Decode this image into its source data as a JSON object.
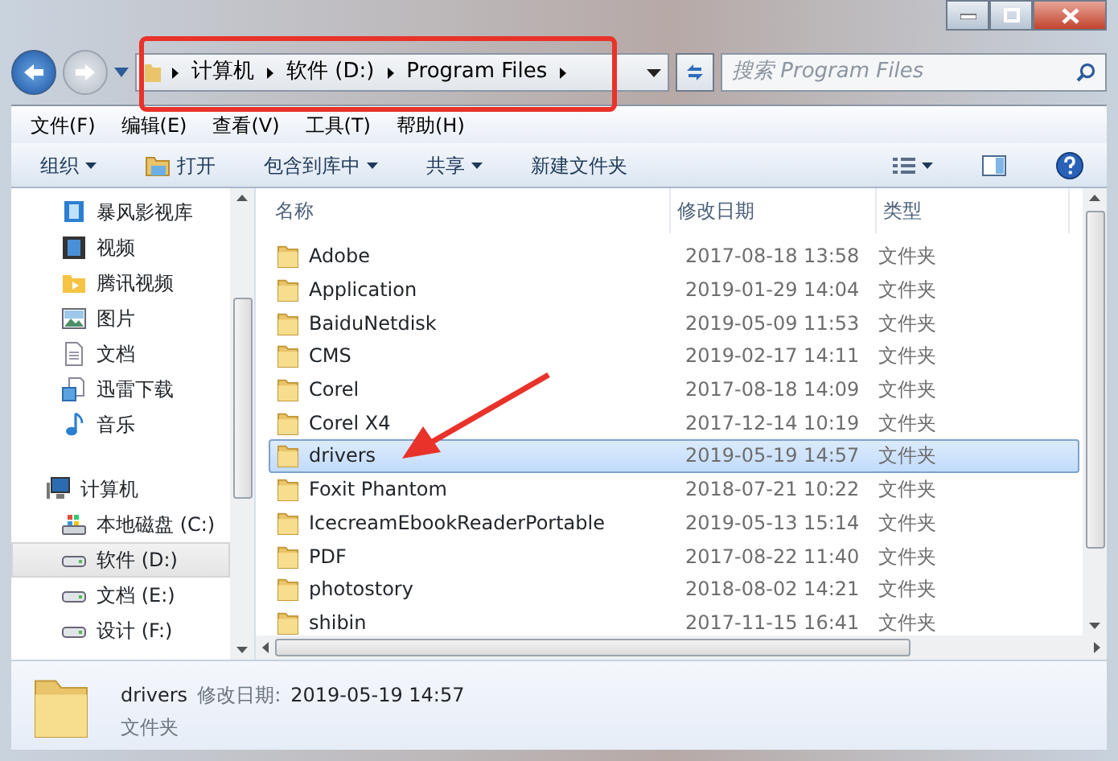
{
  "address": {
    "crumbs": [
      "计算机",
      "软件 (D:)",
      "Program Files"
    ]
  },
  "search": {
    "placeholder": "搜索 Program Files"
  },
  "menu": [
    "文件(F)",
    "编辑(E)",
    "查看(V)",
    "工具(T)",
    "帮助(H)"
  ],
  "toolbar": [
    {
      "label": "组织",
      "kind": "menu"
    },
    {
      "label": "打开",
      "kind": "open"
    },
    {
      "label": "包含到库中",
      "kind": "menu"
    },
    {
      "label": "共享",
      "kind": "menu"
    },
    {
      "label": "新建文件夹",
      "kind": "plain"
    }
  ],
  "sidebar": {
    "libraries": [
      {
        "label": "暴风影视库",
        "kind": "videolib",
        "selected": false
      },
      {
        "label": "视频",
        "kind": "video",
        "selected": false
      },
      {
        "label": "腾讯视频",
        "kind": "tencent",
        "selected": false
      },
      {
        "label": "图片",
        "kind": "picture",
        "selected": false
      },
      {
        "label": "文档",
        "kind": "document",
        "selected": false
      },
      {
        "label": "迅雷下载",
        "kind": "download",
        "selected": false
      },
      {
        "label": "音乐",
        "kind": "music",
        "selected": false
      }
    ],
    "computer": {
      "label": "计算机",
      "children": [
        {
          "label": "本地磁盘 (C:)",
          "kind": "system",
          "selected": false
        },
        {
          "label": "软件 (D:)",
          "kind": "drive",
          "selected": true
        },
        {
          "label": "文档 (E:)",
          "kind": "drive",
          "selected": false
        },
        {
          "label": "设计 (F:)",
          "kind": "drive",
          "selected": false
        }
      ]
    }
  },
  "files": {
    "columns": [
      "名称",
      "修改日期",
      "类型"
    ],
    "rows": [
      {
        "name": "Adobe",
        "modified": "2017-08-18 13:58",
        "type": "文件夹",
        "selected": false
      },
      {
        "name": "Application",
        "modified": "2019-01-29 14:04",
        "type": "文件夹",
        "selected": false
      },
      {
        "name": "BaiduNetdisk",
        "modified": "2019-05-09 11:53",
        "type": "文件夹",
        "selected": false
      },
      {
        "name": "CMS",
        "modified": "2019-02-17 14:11",
        "type": "文件夹",
        "selected": false
      },
      {
        "name": "Corel",
        "modified": "2017-08-18 14:09",
        "type": "文件夹",
        "selected": false
      },
      {
        "name": "Corel X4",
        "modified": "2017-12-14 10:19",
        "type": "文件夹",
        "selected": false
      },
      {
        "name": "drivers",
        "modified": "2019-05-19 14:57",
        "type": "文件夹",
        "selected": true
      },
      {
        "name": "Foxit Phantom",
        "modified": "2018-07-21 10:22",
        "type": "文件夹",
        "selected": false
      },
      {
        "name": "IcecreamEbookReaderPortable",
        "modified": "2019-05-13 15:14",
        "type": "文件夹",
        "selected": false
      },
      {
        "name": "PDF",
        "modified": "2017-08-22 11:40",
        "type": "文件夹",
        "selected": false
      },
      {
        "name": "photostory",
        "modified": "2018-08-02 14:21",
        "type": "文件夹",
        "selected": false
      },
      {
        "name": "shibin",
        "modified": "2017-11-15 16:41",
        "type": "文件夹",
        "selected": false
      }
    ]
  },
  "details": {
    "name": "drivers",
    "label": "修改日期:",
    "value": "2019-05-19 14:57",
    "type": "文件夹"
  },
  "annotations": [
    {
      "kind": "box"
    },
    {
      "kind": "arrow"
    }
  ]
}
